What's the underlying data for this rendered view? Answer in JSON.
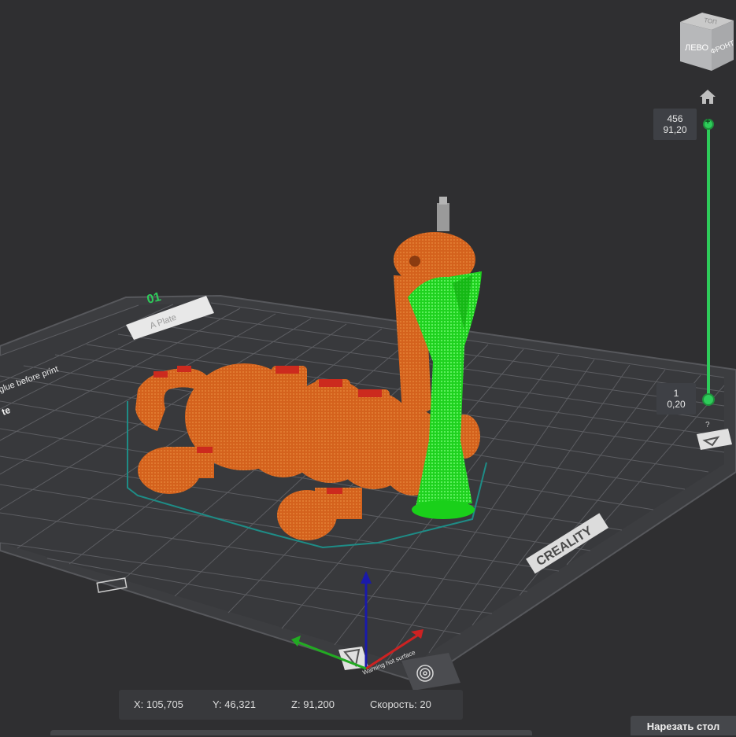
{
  "view_cube": {
    "top_label": "ТОП",
    "left_label": "ЛЕВО",
    "front_label": "ФРОНТ"
  },
  "layer_slider": {
    "top": {
      "layer": "456",
      "height": "91,20"
    },
    "bottom": {
      "layer": "1",
      "height": "0,20"
    },
    "help": "?"
  },
  "plate": {
    "number": "01",
    "tab_label": "A Plate",
    "glue_note": "glue before print",
    "left_cut_text": "te",
    "brand": "CREALITY",
    "warning_label": "Warning hot surface"
  },
  "status": {
    "x_label": "X:",
    "x_value": "105,705",
    "y_label": "Y:",
    "y_value": "46,321",
    "z_label": "Z:",
    "z_value": "91,200",
    "speed_label": "Скорость:",
    "speed_value": "20"
  },
  "slice_button": "Нарезать стол",
  "colors": {
    "background": "#2f2f31",
    "model_orange": "#d9641e",
    "support_green": "#22dd22",
    "slider_green": "#2ecc5a",
    "axis_x": "#cc2222",
    "axis_y": "#22aa22",
    "axis_z": "#1a1aaa"
  }
}
